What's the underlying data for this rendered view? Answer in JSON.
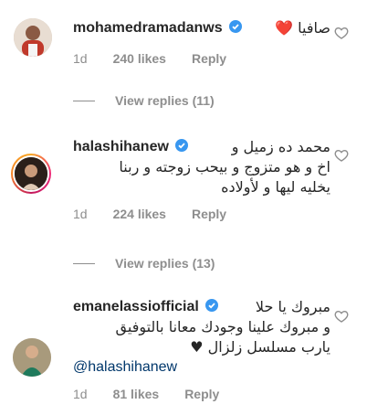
{
  "comments": [
    {
      "username": "mohamedramadanws",
      "text_lines": [
        "صافيا ❤️"
      ],
      "time": "1d",
      "likes": "240 likes",
      "reply": "Reply",
      "view_replies": "View replies (11)"
    },
    {
      "username": "halashihanew",
      "text_first": "محمد ده زميل و",
      "text_lines": [
        "اخ و هو متزوج و بيحب زوجته و ربنا",
        "يخليه ليها و لأولاده"
      ],
      "time": "1d",
      "likes": "224 likes",
      "reply": "Reply",
      "view_replies": "View replies (13)"
    },
    {
      "username": "emanelassiofficial",
      "text_first": "مبروك يا حلا",
      "text_lines": [
        "و مبروك علينا وجودك معانا بالتوفيق",
        "يارب مسلسل زلزال ♥"
      ],
      "mention": "@halashihanew",
      "time": "1d",
      "likes": "81 likes",
      "reply": "Reply"
    }
  ],
  "colors": {
    "verified": "#3897f0",
    "heart": "#ed4956",
    "meta": "#8e8e8e",
    "mention": "#00376b"
  },
  "icons": {
    "like": "heart-outline-icon",
    "verified": "verified-badge-icon"
  }
}
